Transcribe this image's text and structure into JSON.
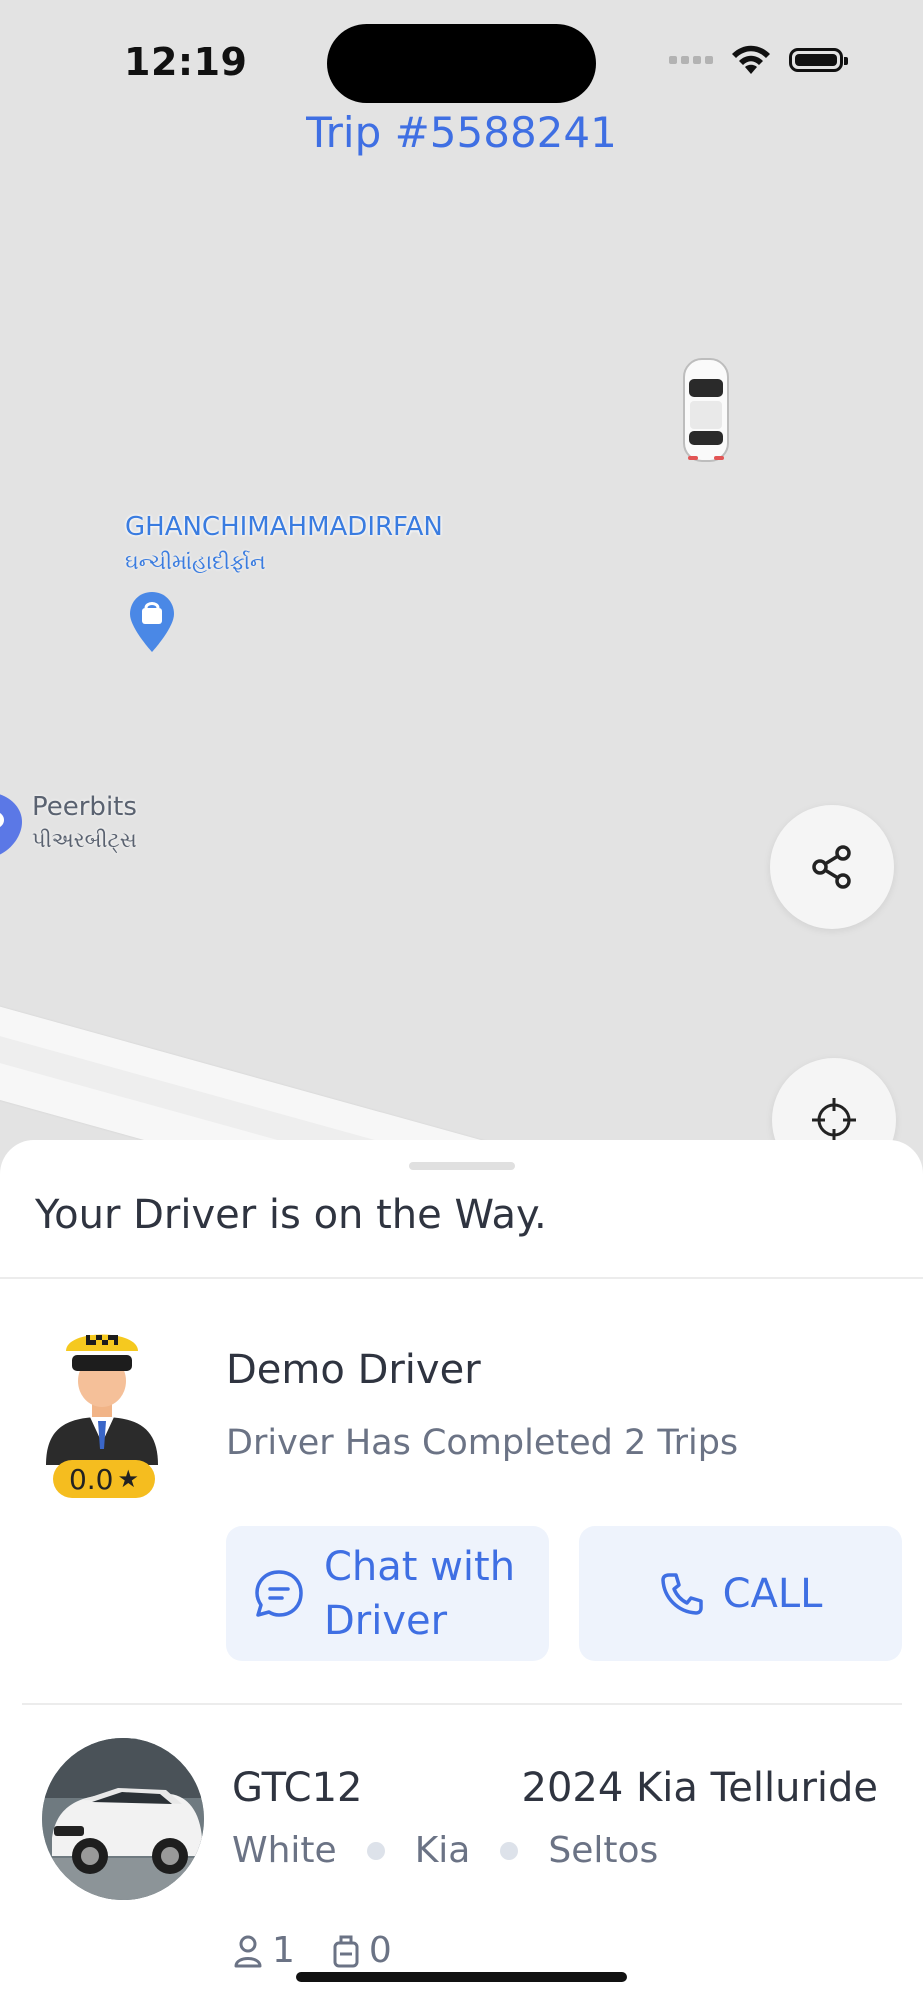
{
  "status_bar": {
    "time": "12:19"
  },
  "header": {
    "trip_title": "Trip #5588241"
  },
  "map": {
    "poi_primary": {
      "name": "GHANCHIMAHMADIRFAN",
      "name_local": "ઘન્ચીમાંહાદીર્ફાન"
    },
    "poi_secondary": {
      "name": "Peerbits",
      "name_local": "પીઅરબીટ્સ"
    }
  },
  "sheet": {
    "title": "Your Driver is on the Way.",
    "driver": {
      "name": "Demo Driver",
      "trips_text": "Driver Has Completed 2 Trips",
      "rating": "0.0"
    },
    "actions": {
      "chat_label": "Chat with Driver",
      "call_label": "CALL"
    },
    "vehicle": {
      "plate": "GTC12",
      "model": "2024 Kia Telluride",
      "color": "White",
      "make": "Kia",
      "variant": "Seltos",
      "passengers": "1",
      "luggage": "0"
    }
  },
  "colors": {
    "accent": "#3f6fe3",
    "rating_bg": "#f5bd1f",
    "button_bg": "#eef3fc"
  }
}
